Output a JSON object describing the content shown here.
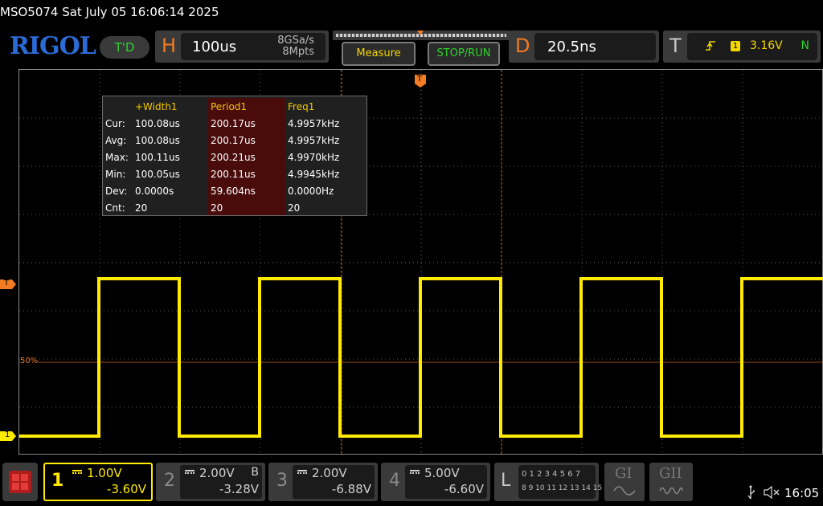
{
  "title_bar": {
    "text": "MSO5074  Sat July 05 16:06:14 2025"
  },
  "header": {
    "logo": "RIGOL",
    "trigger_status": "T'D",
    "horizontal": {
      "letter": "H",
      "timebase": "100us",
      "sample_rate": "8GSa/s",
      "memory_depth": "8Mpts"
    },
    "measure_button": "Measure",
    "stop_run_button": "STOP/RUN",
    "delay": {
      "letter": "D",
      "value": "20.5ns"
    },
    "trigger": {
      "letter": "T",
      "channel": "1",
      "level": "3.16V",
      "mode": "N"
    }
  },
  "markers": {
    "left_trigger": "T",
    "threshold_label": "50%",
    "channel_marker": "1",
    "top_trigger": "T"
  },
  "measurements": {
    "headers": [
      "+Width1",
      "Period1",
      "Freq1"
    ],
    "rows": [
      {
        "label": "Cur:",
        "values": [
          "100.08us",
          "200.17us",
          "4.9957kHz"
        ]
      },
      {
        "label": "Avg:",
        "values": [
          "100.08us",
          "200.17us",
          "4.9957kHz"
        ]
      },
      {
        "label": "Max:",
        "values": [
          "100.11us",
          "200.21us",
          "4.9970kHz"
        ]
      },
      {
        "label": "Min:",
        "values": [
          "100.05us",
          "200.11us",
          "4.9945kHz"
        ]
      },
      {
        "label": "Dev:",
        "values": [
          "0.0000s",
          "59.604ns",
          "0.0000Hz"
        ]
      },
      {
        "label": "Cnt:",
        "values": [
          "20",
          "20",
          "20"
        ]
      }
    ]
  },
  "channels": [
    {
      "number": "1",
      "scale": "1.00V",
      "offset": "-3.60V",
      "flag": "",
      "active": true
    },
    {
      "number": "2",
      "scale": "2.00V",
      "offset": "-3.28V",
      "flag": "B",
      "active": false
    },
    {
      "number": "3",
      "scale": "2.00V",
      "offset": "-6.88V",
      "flag": "",
      "active": false
    },
    {
      "number": "4",
      "scale": "5.00V",
      "offset": "-6.60V",
      "flag": "",
      "active": false
    }
  ],
  "logic": {
    "letter": "L",
    "row1": "0 1 2 3   4 5 6 7",
    "row2": "8 9 10 11  12 13 14 15"
  },
  "generators": [
    "GI",
    "GII"
  ],
  "status": {
    "time": "16:05"
  },
  "colors": {
    "ch1": "#ffea00",
    "accent": "#f37b21",
    "green": "#2fd12f",
    "logo": "#2b6bd6"
  }
}
